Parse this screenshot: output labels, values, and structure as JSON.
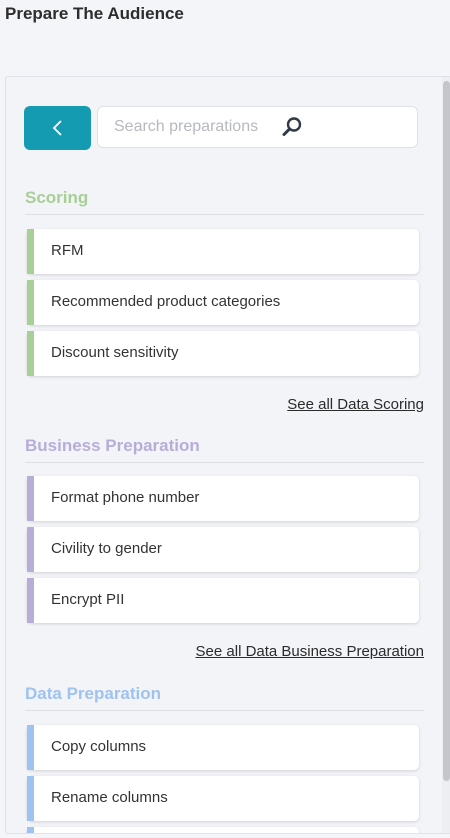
{
  "page": {
    "title": "Prepare The Audience"
  },
  "search": {
    "placeholder": "Search preparations"
  },
  "icons": {
    "back": "chevron-left-icon",
    "search": "magnifier-icon"
  },
  "colors": {
    "back_button": "#149bb1",
    "scoring": "#a8cf97",
    "business": "#b7aed8",
    "data": "#9ec3f0"
  },
  "sections": [
    {
      "title": "Scoring",
      "items": [
        "RFM",
        "Recommended product categories",
        "Discount sensitivity"
      ],
      "see_all": "See all Data Scoring"
    },
    {
      "title": "Business Preparation",
      "items": [
        "Format phone number",
        "Civility to gender",
        "Encrypt PII"
      ],
      "see_all": "See all Data Business Preparation"
    },
    {
      "title": "Data Preparation",
      "items": [
        "Copy columns",
        "Rename columns"
      ]
    }
  ]
}
